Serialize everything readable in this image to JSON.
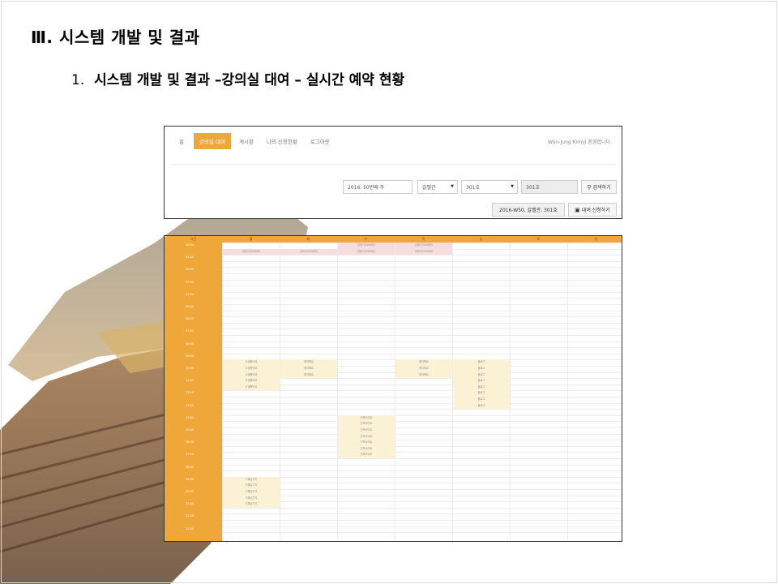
{
  "slide": {
    "title": "Ⅲ. 시스템 개발 및 결과",
    "subtitle_num": "1.",
    "subtitle_text": "시스템 개발 및 결과 –강의실 대여 – 실시간 예약 현황"
  },
  "navbar": {
    "home": "홈",
    "items": [
      "강의실 대여",
      "게시판",
      "나의 신청현황",
      "로그아웃"
    ],
    "welcome": "Won-Jung Kim님 환영합니다."
  },
  "search": {
    "week": "2016. 50번째 주",
    "building": "갈멜관",
    "room": "301호",
    "room_readonly": "301호",
    "search_button": "검색하기",
    "summary": "2016-W50, 갈멜관, 301호",
    "apply_button": "대여 신청하기"
  },
  "timetable": {
    "header_time": "시간",
    "days": [
      "월",
      "화",
      "수",
      "목",
      "금",
      "토",
      "일"
    ],
    "times": [
      "00:00",
      "01:00",
      "02:00",
      "03:00",
      "04:00",
      "05:00",
      "06:00",
      "07:00",
      "08:00",
      "09:00",
      "10:00",
      "11:00",
      "12:00",
      "13:00",
      "14:00",
      "15:00",
      "16:00",
      "17:00",
      "18:00",
      "19:00",
      "20:00",
      "21:00",
      "22:00",
      "23:00"
    ],
    "pink_label": "강대기(2006반)",
    "mon_label": "고생했어요",
    "tue_label": "좋아해요",
    "wed_label": "인포사이트",
    "thu_label": "좋아해요",
    "fri_label": "블로그",
    "mon_evening_label": "기록남기기"
  },
  "colors": {
    "accent": "#f0a73a",
    "reserved_pink": "#f6dede",
    "reserved_yellow": "#fbf2d5"
  }
}
